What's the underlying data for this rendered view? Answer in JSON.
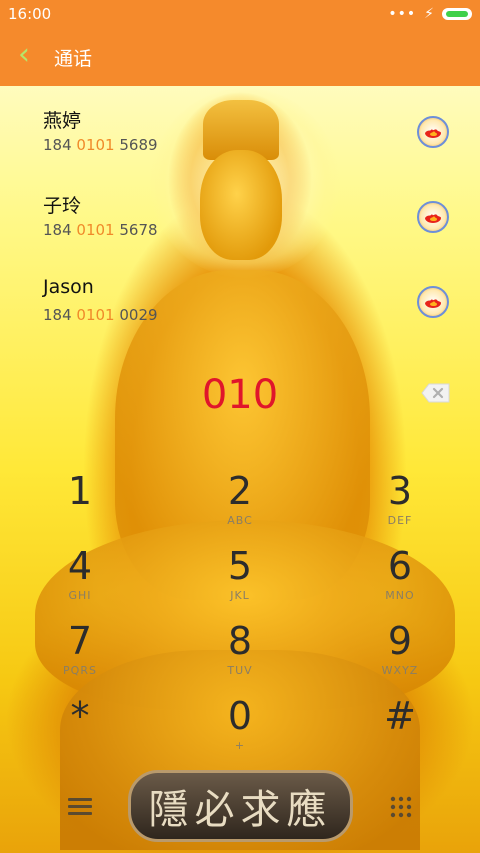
{
  "status_bar": {
    "time": "16:00",
    "more_dots": "•••",
    "charging": "⚡"
  },
  "action_bar": {
    "back": "‹",
    "title": "通话"
  },
  "contacts": [
    {
      "name": "燕婷",
      "number_pre": "184 ",
      "number_match": "0101",
      "number_post": " 5689"
    },
    {
      "name": "子玲",
      "number_pre": "184 ",
      "number_match": "0101",
      "number_post": " 5678"
    },
    {
      "name": "Jason",
      "number_pre": "184 ",
      "number_match": "0101",
      "number_post": " 0029"
    }
  ],
  "dialed": "010",
  "keypad": [
    {
      "digit": "1",
      "letters": ""
    },
    {
      "digit": "2",
      "letters": "ABC"
    },
    {
      "digit": "3",
      "letters": "DEF"
    },
    {
      "digit": "4",
      "letters": "GHI"
    },
    {
      "digit": "5",
      "letters": "JKL"
    },
    {
      "digit": "6",
      "letters": "MNO"
    },
    {
      "digit": "7",
      "letters": "PQRS"
    },
    {
      "digit": "8",
      "letters": "TUV"
    },
    {
      "digit": "9",
      "letters": "WXYZ"
    },
    {
      "digit": "*",
      "letters": ""
    },
    {
      "digit": "0",
      "letters": "+"
    },
    {
      "digit": "#",
      "letters": ""
    }
  ],
  "plaque": "隱必求應",
  "colors": {
    "accent": "#f58a2c",
    "match": "#f08a2a",
    "dialed": "#e0152b"
  },
  "icons": {
    "menu": "menu-icon",
    "dial": "dial-call-icon",
    "keypad": "keypad-icon"
  }
}
